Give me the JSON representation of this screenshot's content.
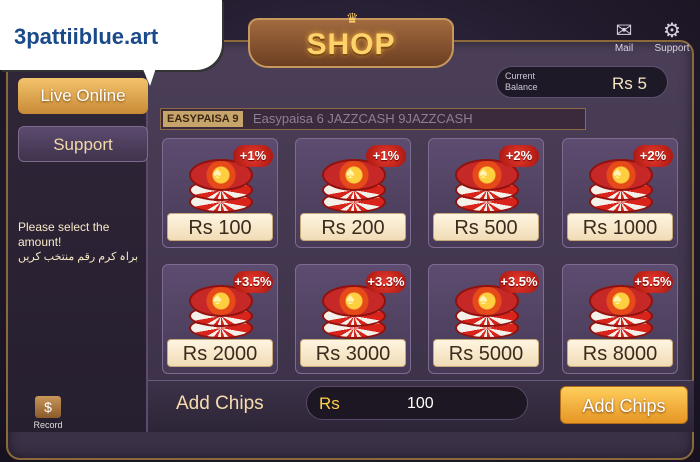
{
  "watermark": {
    "text": "3pattiiblue.art"
  },
  "header": {
    "title": "SHOP",
    "mail_label": "Mail",
    "support_label": "Support"
  },
  "balance": {
    "label": "Current Balance",
    "value": "Rs 5"
  },
  "sidebar": {
    "items": [
      {
        "label": "Live Online",
        "active": true
      },
      {
        "label": "Support",
        "active": false
      }
    ],
    "note_en": "Please select the amount!",
    "note_ur": "براہ کرم رقم منتخب کریں",
    "record_label": "Record"
  },
  "payment": {
    "selected_tag": "EASYPAISA 9",
    "options_text": "Easypaisa 6 JAZZCASH 9JAZZCASH"
  },
  "packages": [
    {
      "price": "Rs 100",
      "bonus": "+1%"
    },
    {
      "price": "Rs 200",
      "bonus": "+1%"
    },
    {
      "price": "Rs 500",
      "bonus": "+2%"
    },
    {
      "price": "Rs 1000",
      "bonus": "+2%"
    },
    {
      "price": "Rs 2000",
      "bonus": "+3.5%"
    },
    {
      "price": "Rs 3000",
      "bonus": "+3.3%"
    },
    {
      "price": "Rs 5000",
      "bonus": "+3.5%"
    },
    {
      "price": "Rs 8000",
      "bonus": "+5.5%"
    }
  ],
  "add_chips": {
    "label": "Add Chips",
    "prefix": "Rs",
    "amount": "100",
    "button_label": "Add Chips"
  },
  "colors": {
    "accent_gold": "#ffd36b",
    "bonus_red": "#e83b2e",
    "button_orange": "#e69624"
  }
}
